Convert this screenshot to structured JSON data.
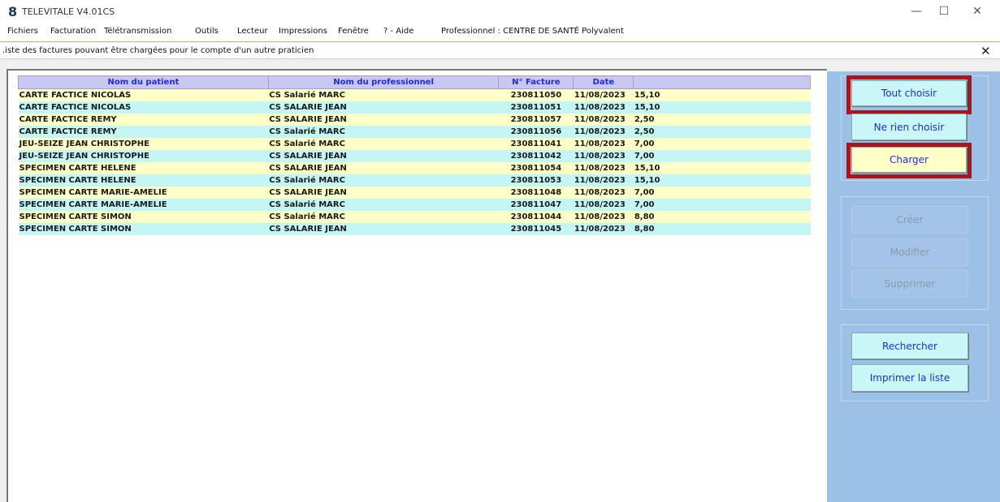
{
  "window": {
    "app_icon": "8",
    "title": "TELEVITALE V4.01CS",
    "minimize": "—",
    "maximize": "☐",
    "close": "✕"
  },
  "menu": {
    "items": [
      "Fichiers",
      "Facturation",
      "Télétransmission",
      "Outils",
      "Lecteur",
      "Impressions",
      "Fenêtre",
      "? - Aide"
    ],
    "professional": "Professionnel : CENTRE DE SANTÉ Polyvalent"
  },
  "subwindow": {
    "title": ".iste des factures pouvant être chargées pour le compte d'un autre praticien",
    "close": "✕"
  },
  "table": {
    "headers": [
      "Nom du patient",
      "Nom du professionnel",
      "N° Facture",
      "Date",
      ""
    ],
    "rows": [
      [
        "CARTE FACTICE NICOLAS",
        "CS Salarié MARC",
        "230811050",
        "11/08/2023",
        "15,10"
      ],
      [
        "CARTE FACTICE NICOLAS",
        "CS SALARIE JEAN",
        "230811051",
        "11/08/2023",
        "15,10"
      ],
      [
        "CARTE FACTICE REMY",
        "CS SALARIE JEAN",
        "230811057",
        "11/08/2023",
        "2,50"
      ],
      [
        "CARTE FACTICE REMY",
        "CS Salarié MARC",
        "230811056",
        "11/08/2023",
        "2,50"
      ],
      [
        "JEU-SEIZE JEAN CHRISTOPHE",
        "CS Salarié MARC",
        "230811041",
        "11/08/2023",
        "7,00"
      ],
      [
        "JEU-SEIZE JEAN CHRISTOPHE",
        "CS SALARIE JEAN",
        "230811042",
        "11/08/2023",
        "7,00"
      ],
      [
        "SPECIMEN CARTE HELENE",
        "CS SALARIE JEAN",
        "230811054",
        "11/08/2023",
        "15,10"
      ],
      [
        "SPECIMEN CARTE HELENE",
        "CS Salarié MARC",
        "230811053",
        "11/08/2023",
        "15,10"
      ],
      [
        "SPECIMEN CARTE MARIE-AMELIE",
        "CS SALARIE JEAN",
        "230811048",
        "11/08/2023",
        "7,00"
      ],
      [
        "SPECIMEN CARTE MARIE-AMELIE",
        "CS Salarié MARC",
        "230811047",
        "11/08/2023",
        "7,00"
      ],
      [
        "SPECIMEN CARTE SIMON",
        "CS Salarié MARC",
        "230811044",
        "11/08/2023",
        "8,80"
      ],
      [
        "SPECIMEN CARTE SIMON",
        "CS SALARIE JEAN",
        "230811045",
        "11/08/2023",
        "8,80"
      ]
    ]
  },
  "buttons": {
    "tout_choisir": "Tout choisir",
    "ne_rien_choisir": "Ne rien choisir",
    "charger": "Charger",
    "creer": "Créer",
    "modifier": "Modifier",
    "supprimer": "Supprimer",
    "rechercher": "Rechercher",
    "imprimer_liste": "Imprimer la liste"
  },
  "colors": {
    "row_odd": "#ffffc8",
    "row_even": "#c4f6f6",
    "header": "#c8c8f0",
    "side_panel": "#9dc0e6",
    "highlight_frame": "#a8161c",
    "button_text": "#1d2ce8"
  }
}
